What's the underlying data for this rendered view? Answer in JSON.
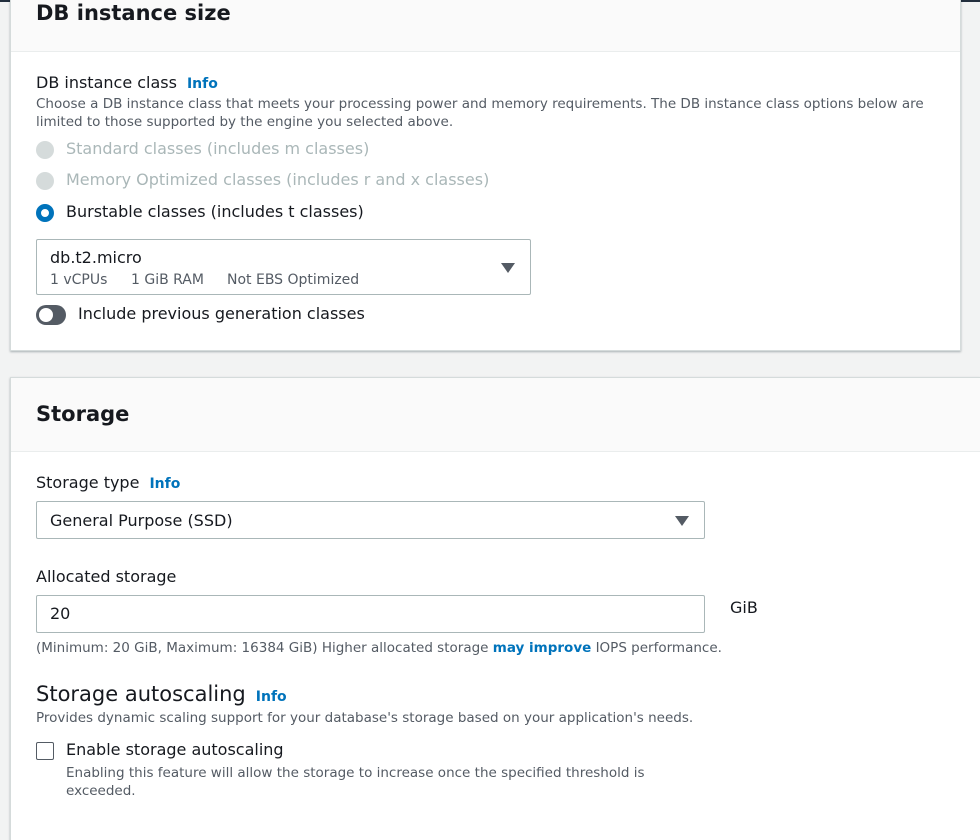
{
  "instance_size": {
    "title": "DB instance size",
    "class_label": "DB instance class",
    "info": "Info",
    "class_description": "Choose a DB instance class that meets your processing power and memory requirements. The DB instance class options below are limited to those supported by the engine you selected above.",
    "options": [
      {
        "label": "Standard classes (includes m classes)",
        "state": "disabled"
      },
      {
        "label": "Memory Optimized classes (includes r and x classes)",
        "state": "disabled"
      },
      {
        "label": "Burstable classes (includes t classes)",
        "state": "selected"
      }
    ],
    "selected_class": {
      "name": "db.t2.micro",
      "vcpus": "1 vCPUs",
      "ram": "1 GiB RAM",
      "ebs": "Not EBS Optimized"
    },
    "toggle_label": "Include previous generation classes",
    "toggle_on": false
  },
  "storage": {
    "title": "Storage",
    "type_label": "Storage type",
    "info": "Info",
    "type_value": "General Purpose (SSD)",
    "allocated_label": "Allocated storage",
    "allocated_value": "20",
    "unit": "GiB",
    "constraint_prefix": "(Minimum: 20 GiB, Maximum: 16384 GiB) Higher allocated storage ",
    "constraint_link": "may improve",
    "constraint_suffix": " IOPS performance.",
    "autoscaling_title": "Storage autoscaling",
    "autoscaling_info": "Info",
    "autoscaling_description": "Provides dynamic scaling support for your database's storage based on your application's needs.",
    "autoscaling_checkbox_label": "Enable storage autoscaling",
    "autoscaling_checked": false,
    "autoscaling_help": "Enabling this feature will allow the storage to increase once the specified threshold is exceeded."
  },
  "colors": {
    "accent": "#0073bb",
    "text": "#16191f",
    "secondary_text": "#545b64",
    "disabled": "#aab7b8"
  }
}
